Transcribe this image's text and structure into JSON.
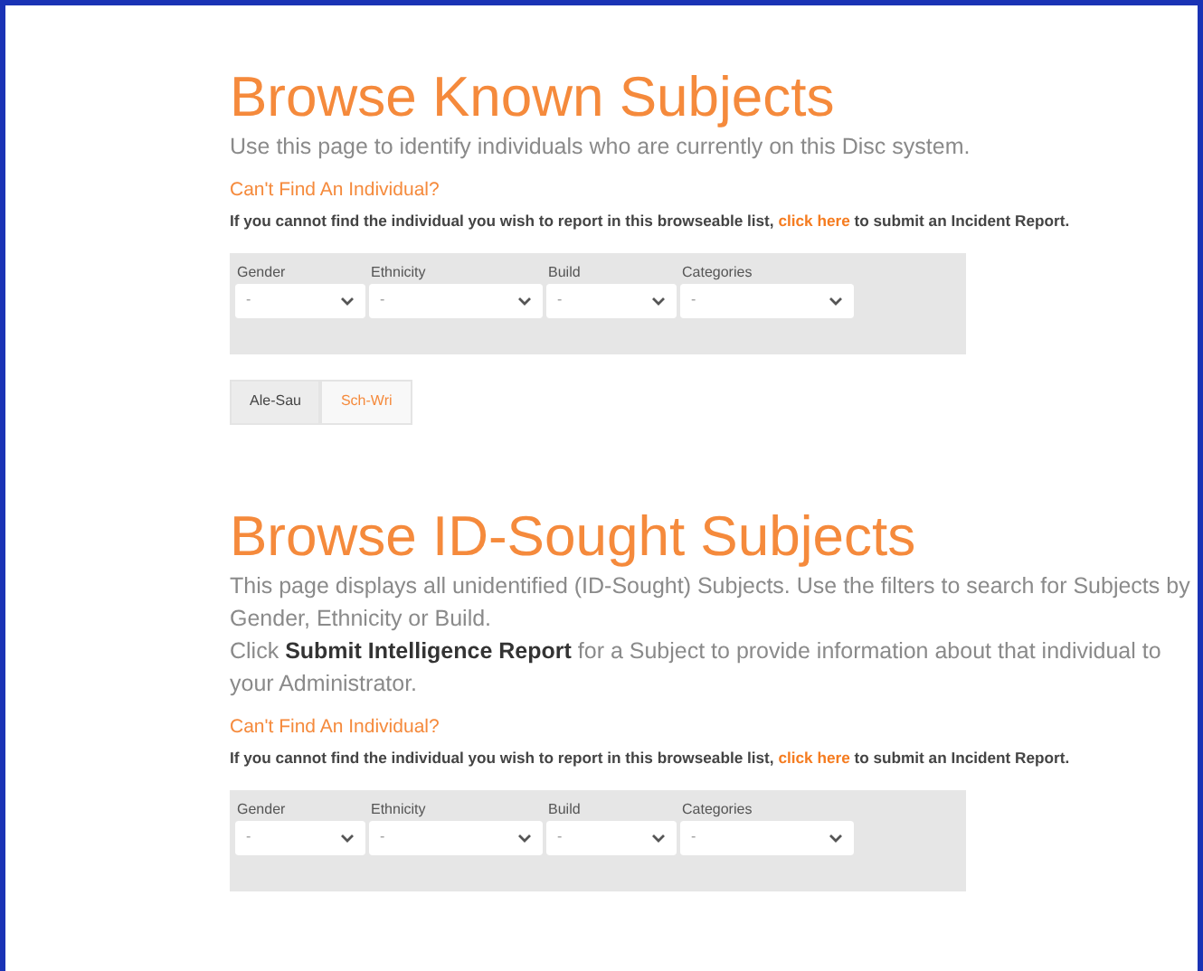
{
  "sections": [
    {
      "title": "Browse Known Subjects",
      "description": [
        "Use this page to identify individuals who are currently on this Disc system."
      ],
      "help": {
        "heading": "Can't Find An Individual?",
        "text_before": "If you cannot find the individual you wish to report in this browseable list, ",
        "link": "click here",
        "text_after": " to submit an Incident Report."
      },
      "filters": [
        {
          "label": "Gender",
          "value": "-"
        },
        {
          "label": "Ethnicity",
          "value": "-"
        },
        {
          "label": "Build",
          "value": "-"
        },
        {
          "label": "Categories",
          "value": "-"
        }
      ],
      "tabs": [
        {
          "label": "Ale-Sau",
          "selected": true
        },
        {
          "label": "Sch-Wri",
          "selected": false
        }
      ]
    },
    {
      "title": "Browse ID-Sought Subjects",
      "description": [
        "This page displays all unidentified (ID-Sought) Subjects. Use the filters to search for Subjects by Gender, Ethnicity or Build.",
        "Click **Submit Intelligence Report** for a Subject to provide information about that individual to your Administrator."
      ],
      "help": {
        "heading": "Can't Find An Individual?",
        "text_before": "If you cannot find the individual you wish to report in this browseable list, ",
        "link": "click here",
        "text_after": " to submit an Incident Report."
      },
      "filters": [
        {
          "label": "Gender",
          "value": "-"
        },
        {
          "label": "Ethnicity",
          "value": "-"
        },
        {
          "label": "Build",
          "value": "-"
        },
        {
          "label": "Categories",
          "value": "-"
        }
      ]
    }
  ]
}
